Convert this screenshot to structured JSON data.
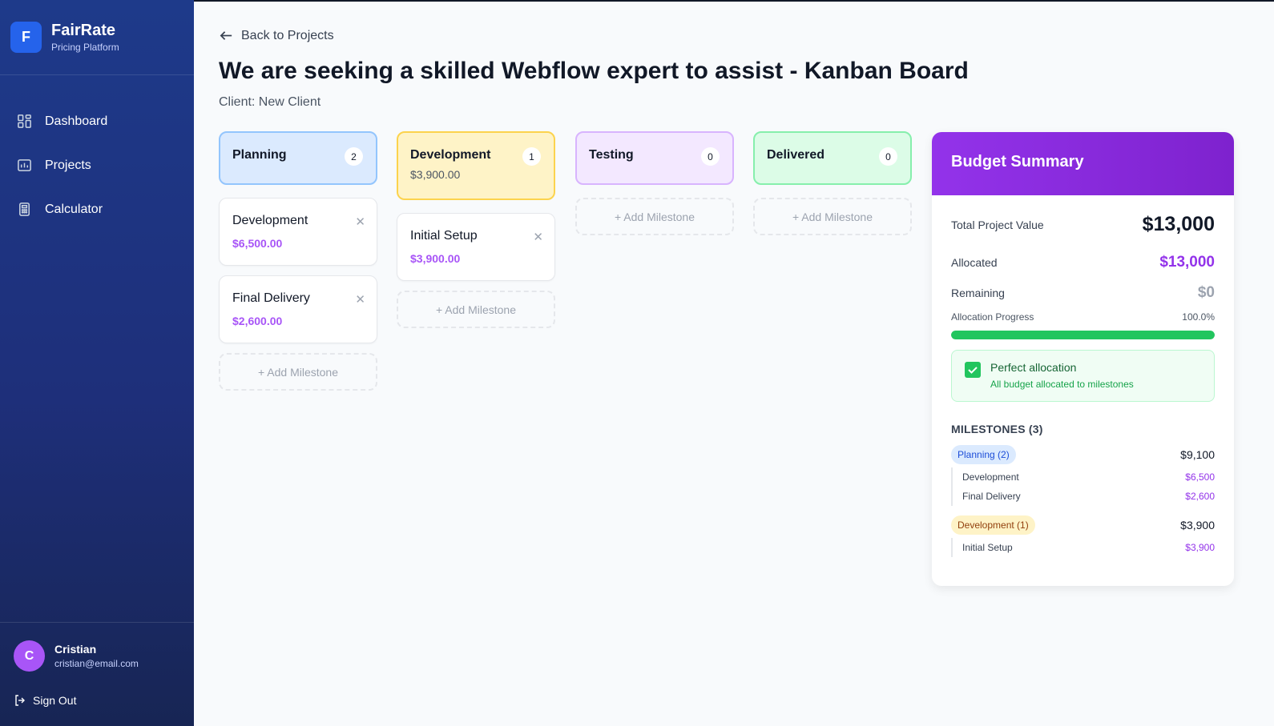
{
  "brand": {
    "logo_letter": "F",
    "name": "FairRate",
    "tagline": "Pricing Platform"
  },
  "nav": [
    {
      "label": "Dashboard",
      "icon": "dashboard-icon"
    },
    {
      "label": "Projects",
      "icon": "chart-icon"
    },
    {
      "label": "Calculator",
      "icon": "calculator-icon"
    }
  ],
  "user": {
    "initial": "C",
    "name": "Cristian",
    "email": "cristian@email.com",
    "signout_label": "Sign Out"
  },
  "header": {
    "back_label": "Back to Projects",
    "title": "We are seeking a skilled Webflow expert to assist - Kanban Board",
    "client": "Client: New Client"
  },
  "columns": [
    {
      "title": "Planning",
      "count": "2",
      "sum": "",
      "bg": "#dbeafe",
      "border": "#93c5fd",
      "cards": [
        {
          "title": "Development",
          "price": "$6,500.00"
        },
        {
          "title": "Final Delivery",
          "price": "$2,600.00"
        }
      ],
      "add_label": "+ Add Milestone"
    },
    {
      "title": "Development",
      "count": "1",
      "sum": "$3,900.00",
      "bg": "#fef3c7",
      "border": "#fcd34d",
      "cards": [
        {
          "title": "Initial Setup",
          "price": "$3,900.00"
        }
      ],
      "add_label": "+ Add Milestone"
    },
    {
      "title": "Testing",
      "count": "0",
      "sum": "",
      "bg": "#f3e8ff",
      "border": "#d8b4fe",
      "cards": [],
      "add_label": "+ Add Milestone"
    },
    {
      "title": "Delivered",
      "count": "0",
      "sum": "",
      "bg": "#dcfce7",
      "border": "#86efac",
      "cards": [],
      "add_label": "+ Add Milestone"
    }
  ],
  "budget": {
    "title": "Budget Summary",
    "total_label": "Total Project Value",
    "total_value": "$13,000",
    "allocated_label": "Allocated",
    "allocated_value": "$13,000",
    "remaining_label": "Remaining",
    "remaining_value": "$0",
    "progress_label": "Allocation Progress",
    "progress_text": "100.0%",
    "progress_fraction": 1.0,
    "status_title": "Perfect allocation",
    "status_sub": "All budget allocated to milestones",
    "milestones_heading": "MILESTONES (3)",
    "groups": [
      {
        "label": "Planning (2)",
        "total": "$9,100",
        "color": "blue",
        "items": [
          {
            "name": "Development",
            "price": "$6,500"
          },
          {
            "name": "Final Delivery",
            "price": "$2,600"
          }
        ]
      },
      {
        "label": "Development (1)",
        "total": "$3,900",
        "color": "yellow",
        "items": [
          {
            "name": "Initial Setup",
            "price": "$3,900"
          }
        ]
      }
    ]
  },
  "colors": {
    "accent": "#9333ea",
    "sidebar": "#1e3a8a",
    "success": "#22c55e"
  }
}
